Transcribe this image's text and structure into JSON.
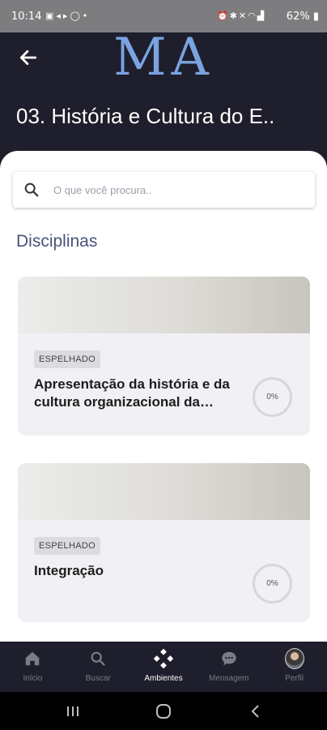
{
  "status_bar": {
    "time": "10:14",
    "left_icons": [
      "gallery-icon",
      "data-saver-icon",
      "whatsapp-icon",
      "dot-icon"
    ],
    "right_icons": [
      "alarm-icon",
      "bluetooth-icon",
      "mute-icon",
      "wifi-icon",
      "signal-icon"
    ],
    "battery": "62%"
  },
  "header": {
    "back_icon": "arrow-left-icon",
    "logo_text": "MA",
    "title": "03. História e Cultura do E..",
    "colors": {
      "background": "#1e1e2c",
      "logo": "#7aa3e0"
    }
  },
  "search": {
    "placeholder": "O que você procura..",
    "value": "",
    "icon": "search-icon"
  },
  "section": {
    "title": "Disciplinas"
  },
  "cards": [
    {
      "badge": "ESPELHADO",
      "title": "Apresentação da história e da cultura organizacional da Ecoresponsabilidade",
      "progress": "0%"
    },
    {
      "badge": "ESPELHADO",
      "title": "Integração",
      "progress": "0%"
    }
  ],
  "bottom_nav": {
    "items": [
      {
        "label": "Início",
        "icon": "home-icon",
        "active": false
      },
      {
        "label": "Buscar",
        "icon": "search-icon",
        "active": false
      },
      {
        "label": "Ambientes",
        "icon": "diamond-grid-icon",
        "active": true
      },
      {
        "label": "Mensagem",
        "icon": "chat-bubble-icon",
        "active": false
      },
      {
        "label": "Perfil",
        "icon": "avatar-icon",
        "active": false
      }
    ]
  },
  "system_nav": {
    "items": [
      "recent-apps-icon",
      "home-circle-icon",
      "back-chevron-icon"
    ]
  }
}
